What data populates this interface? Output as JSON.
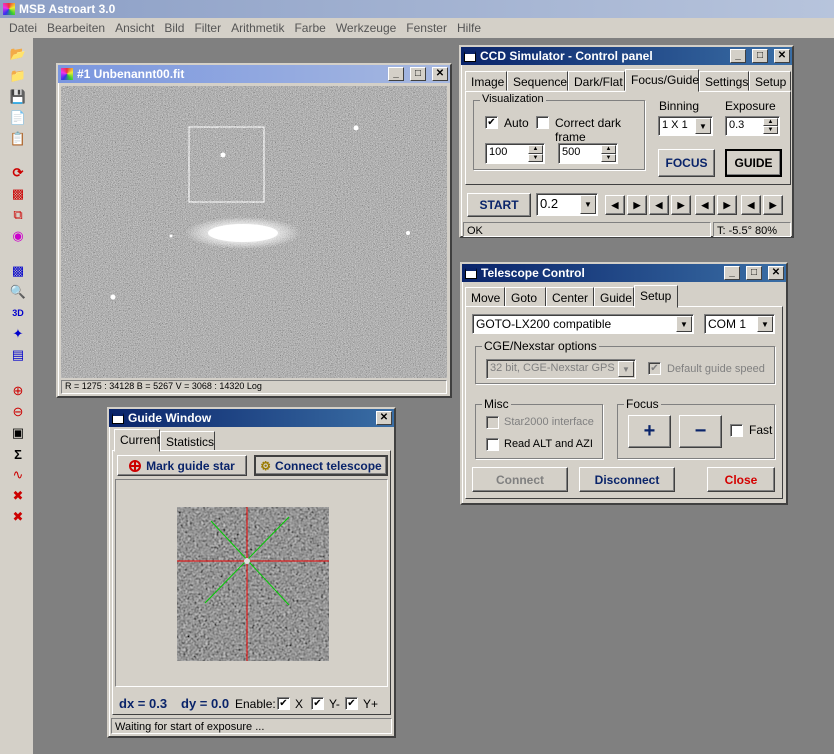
{
  "app": {
    "title": "MSB Astroart 3.0"
  },
  "menu": [
    "Datei",
    "Bearbeiten",
    "Ansicht",
    "Bild",
    "Filter",
    "Arithmetik",
    "Farbe",
    "Werkzeuge",
    "Fenster",
    "Hilfe"
  ],
  "toolbar_icons": [
    "open-folder-icon",
    "open-files-icon",
    "save-icon",
    "copy-icon",
    "paste-icon",
    "refresh-icon",
    "transform-icon",
    "layers-icon",
    "color-icon",
    "histogram-icon",
    "zoom-region-icon",
    "3d-view-icon",
    "stars-icon",
    "clipboard-icon",
    "zoom-in-icon",
    "zoom-out-icon",
    "fit-window-icon",
    "sum-icon",
    "plot-icon",
    "expand-icon",
    "shrink-icon"
  ],
  "image_window": {
    "title": "#1 Unbenannt00.fit",
    "status": "R = 1275 : 34128    B = 5267    V = 3068 : 14320 Log"
  },
  "ccd_panel": {
    "title": "CCD Simulator - Control panel",
    "tabs": [
      "Image",
      "Sequence",
      "Dark/Flat",
      "Focus/Guide",
      "Settings",
      "Setup"
    ],
    "active_tab": "Focus/Guide",
    "visualization_label": "Visualization",
    "auto_label": "Auto",
    "auto_checked": true,
    "dark_label": "Correct dark frame",
    "dark_checked": false,
    "low_value": "100",
    "high_value": "500",
    "binning_label": "Binning",
    "binning_value": "1 X 1",
    "exposure_label": "Exposure",
    "exposure_value": "0.3",
    "focus_button": "FOCUS",
    "guide_button": "GUIDE",
    "start_button": "START",
    "start_value": "0.2",
    "status_text": "OK",
    "temp_text": "T: -5.5°  80%"
  },
  "telescope": {
    "title": "Telescope Control",
    "tabs": [
      "Move",
      "Goto",
      "Center",
      "Guide",
      "Setup"
    ],
    "active_tab": "Setup",
    "driver": "GOTO-LX200 compatible",
    "port": "COM 1",
    "cge_label": "CGE/Nexstar options",
    "cge_value": "32 bit, CGE-Nexstar GPS",
    "default_speed_label": "Default guide speed",
    "misc_label": "Misc",
    "star2000_label": "Star2000 interface",
    "read_alt_label": "Read ALT and AZI",
    "focus_label": "Focus",
    "focus_plus": "+",
    "focus_minus": "−",
    "fast_label": "Fast",
    "connect": "Connect",
    "disconnect": "Disconnect",
    "close": "Close",
    "colors": {
      "disconnect": "#0a246a",
      "close": "#d40000"
    }
  },
  "guide": {
    "title": "Guide Window",
    "tabs": [
      "Current",
      "Statistics"
    ],
    "mark_button": "Mark guide star",
    "connect_button": "Connect telescope",
    "dx": "dx = 0.3",
    "dy": "dy = 0.0",
    "enable_label": "Enable:",
    "x_label": "X",
    "ym_label": "Y-",
    "yp_label": "Y+",
    "status": "Waiting for start of exposure ..."
  }
}
